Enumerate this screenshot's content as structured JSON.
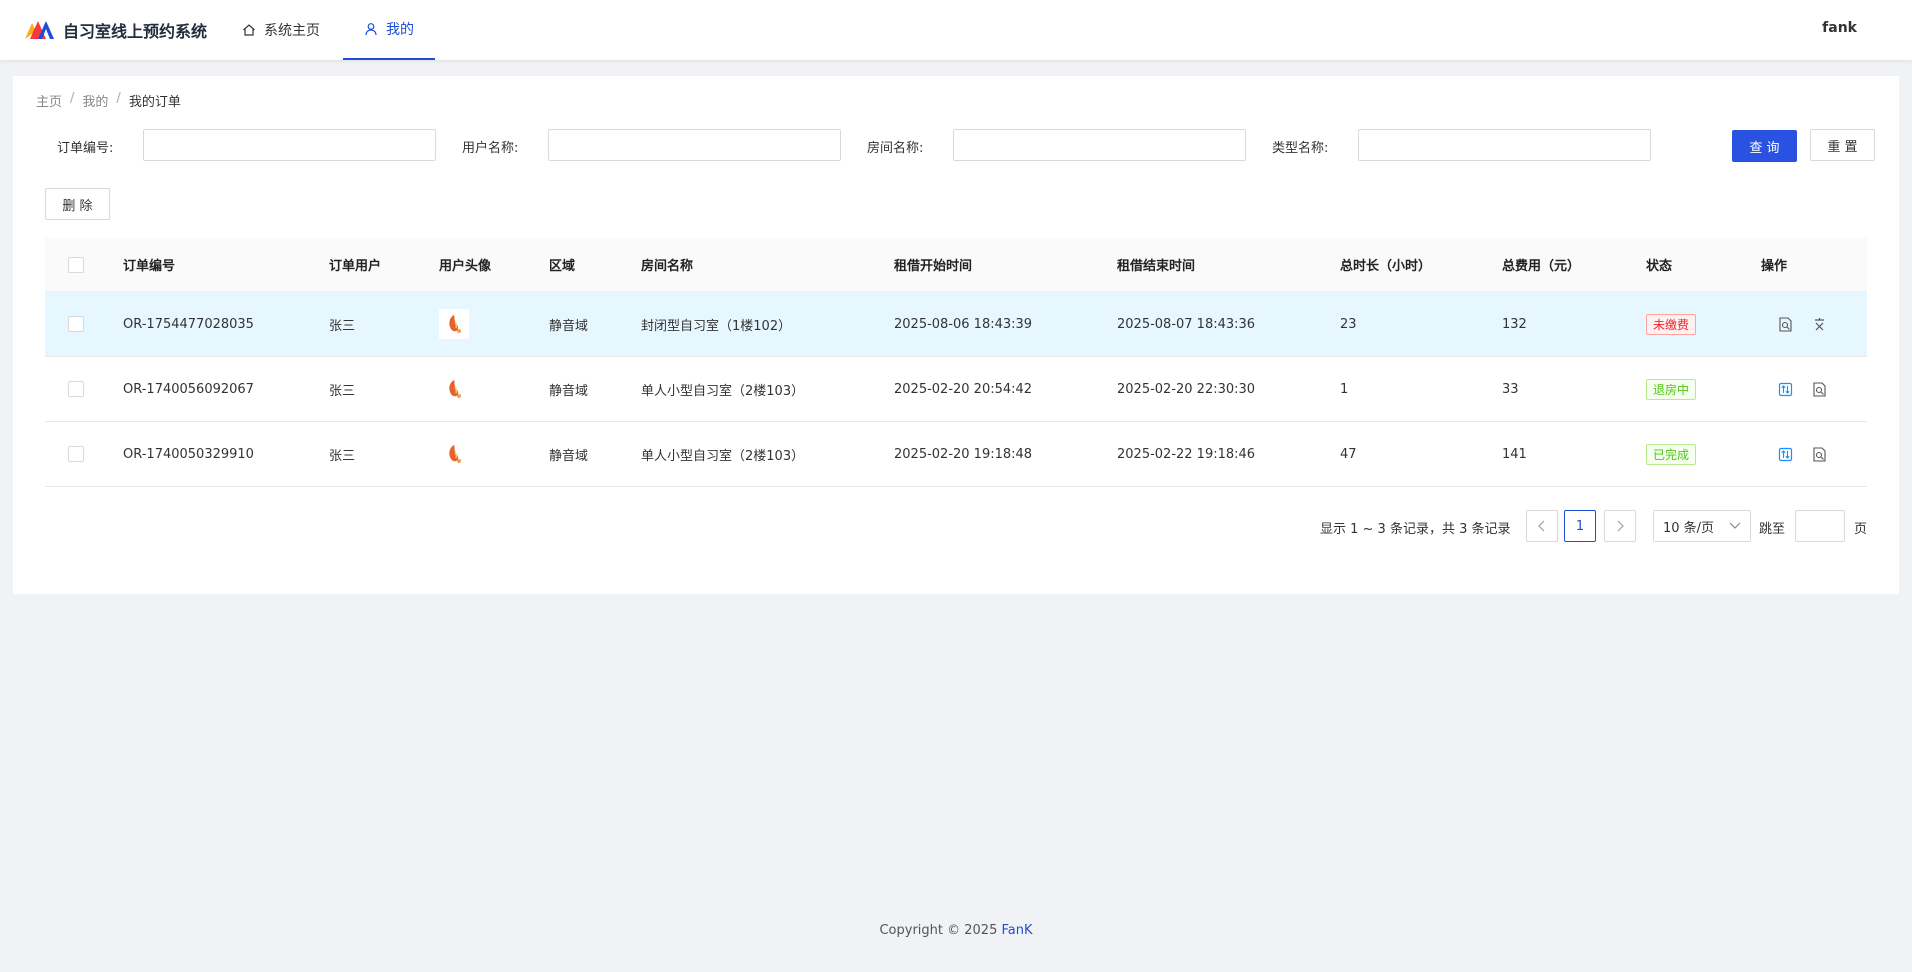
{
  "header": {
    "app_title": "自习室线上预约系统",
    "nav_home": "系统主页",
    "nav_mine": "我的",
    "username": "fank",
    "brand_colors": [
      "#f5222d",
      "#faad14",
      "#1d4ed8"
    ]
  },
  "breadcrumb": {
    "items": [
      "主页",
      "我的",
      "我的订单"
    ],
    "separator": "/"
  },
  "search": {
    "order_no_label": "订单编号:",
    "user_name_label": "用户名称:",
    "room_name_label": "房间名称:",
    "type_name_label": "类型名称:",
    "order_no_value": "",
    "user_name_value": "",
    "room_name_value": "",
    "type_name_value": "",
    "query_label": "查 询",
    "reset_label": "重 置"
  },
  "toolbar": {
    "delete_label": "删 除"
  },
  "table": {
    "headers": [
      "订单编号",
      "订单用户",
      "用户头像",
      "区域",
      "房间名称",
      "租借开始时间",
      "租借结束时间",
      "总时长（小时）",
      "总费用（元）",
      "状态",
      "操作"
    ],
    "rows": [
      {
        "order_no": "OR-1754477028035",
        "user": "张三",
        "area": "静音域",
        "room": "封闭型自习室（1楼102）",
        "start": "2025-08-06 18:43:39",
        "end": "2025-08-07 18:43:36",
        "hours": "23",
        "cost": "132",
        "status": "未缴费",
        "status_color": "red",
        "ops": [
          "detail-icon",
          "pay-icon"
        ]
      },
      {
        "order_no": "OR-1740056092067",
        "user": "张三",
        "area": "静音域",
        "room": "单人小型自习室（2楼103）",
        "start": "2025-02-20 20:54:42",
        "end": "2025-02-20 22:30:30",
        "hours": "1",
        "cost": "33",
        "status": "退房中",
        "status_color": "green",
        "ops": [
          "checkout-icon",
          "detail-icon"
        ]
      },
      {
        "order_no": "OR-1740050329910",
        "user": "张三",
        "area": "静音域",
        "room": "单人小型自习室（2楼103）",
        "start": "2025-02-20 19:18:48",
        "end": "2025-02-22 19:18:46",
        "hours": "47",
        "cost": "141",
        "status": "已完成",
        "status_color": "green",
        "ops": [
          "checkout-icon",
          "detail-icon"
        ]
      }
    ]
  },
  "pagination": {
    "summary": "显示 1 ~ 3 条记录，共 3 条记录",
    "current_page": "1",
    "page_size": "10 条/页",
    "jump_label": "跳至",
    "page_suffix": "页"
  },
  "footer": {
    "copyright": "Copyright © 2025 ",
    "brand": "FanK"
  }
}
